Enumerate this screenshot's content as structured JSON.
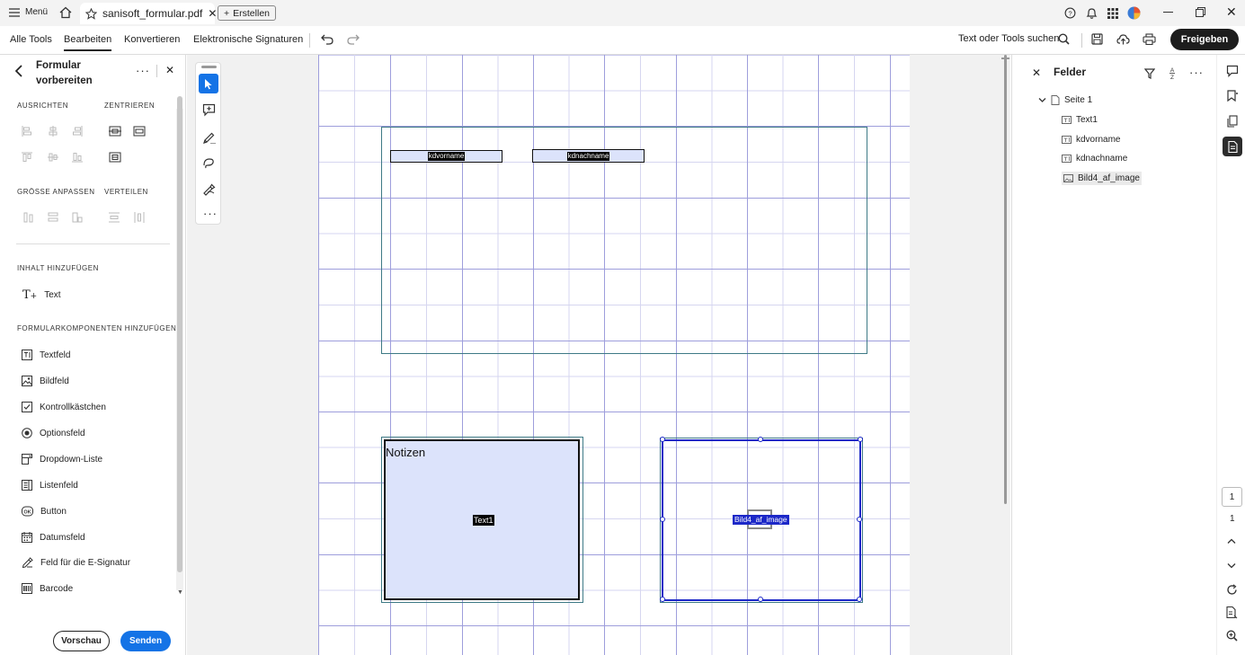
{
  "titlebar": {
    "menu_label": "Menü",
    "tab_title": "sanisoft_formular.pdf",
    "new_label": "Erstellen"
  },
  "menubar": {
    "items": [
      "Alle Tools",
      "Bearbeiten",
      "Konvertieren",
      "Elektronische Signaturen"
    ],
    "search_label": "Text oder Tools suchen",
    "share_label": "Freigeben"
  },
  "leftpanel": {
    "title_line1": "Formular",
    "title_line2": "vorbereiten",
    "align_label": "AUSRICHTEN",
    "center_label": "ZENTRIEREN",
    "resize_label": "GRÖSSE ANPASSEN",
    "distribute_label": "VERTEILEN",
    "add_content_label": "INHALT HINZUFÜGEN",
    "text_tool": "Text",
    "add_components_label": "FORMULARKOMPONENTEN HINZUFÜGEN",
    "components": [
      "Textfeld",
      "Bildfeld",
      "Kontrollkästchen",
      "Optionsfeld",
      "Dropdown-Liste",
      "Listenfeld",
      "Button",
      "Datumsfeld",
      "Feld für die E-Signatur",
      "Barcode"
    ],
    "preview_label": "Vorschau",
    "send_label": "Senden"
  },
  "document": {
    "field_kdvorname": "kdvorname",
    "field_kdnachname": "kdnachname",
    "notes_heading": "Notizen",
    "field_text1": "Text1",
    "field_image": "Bild4_af_image"
  },
  "rightpanel": {
    "title": "Felder",
    "page_node": "Seite 1",
    "fields": [
      "Text1",
      "kdvorname",
      "kdnachname",
      "Bild4_af_image"
    ]
  },
  "rightrail": {
    "page_current": "1",
    "page_total": "1"
  },
  "colors": {
    "accent": "#1473e6",
    "grid_line": "#b8b8e8",
    "field_fill": "#dce3fb",
    "selection": "#1c28c8"
  }
}
